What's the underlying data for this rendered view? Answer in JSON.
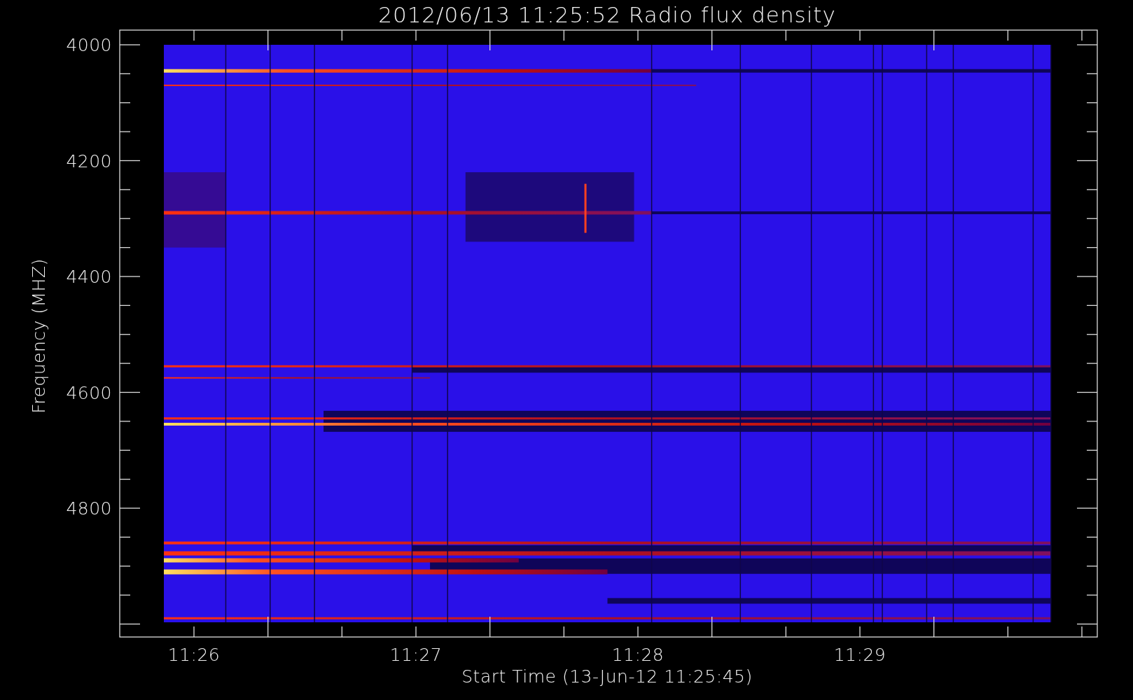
{
  "plot": {
    "title": "2012/06/13 11:25:52 Radio flux density",
    "y_axis": {
      "label": "Frequency (MHZ)",
      "ticks": [
        "4000",
        "4200",
        "4400",
        "4600",
        "4800"
      ]
    },
    "x_axis": {
      "label": "Start Time (13-Jun-12 11:25:45)",
      "ticks": [
        "11:26",
        "11:27",
        "11:28",
        "11:29"
      ]
    }
  }
}
